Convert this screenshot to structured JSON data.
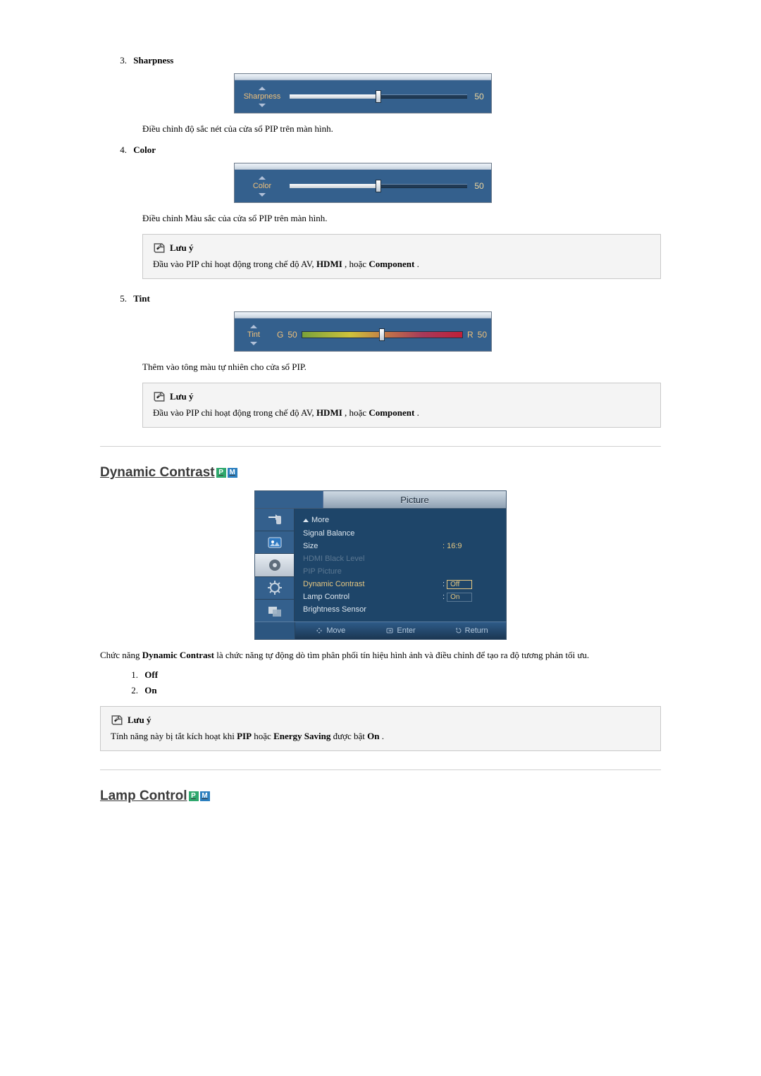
{
  "items": {
    "sharpness": {
      "number": "3.",
      "heading": "Sharpness",
      "slider_label": "Sharpness",
      "value": "50",
      "desc": "Điều chỉnh độ sắc nét của cửa sổ PIP trên màn hình."
    },
    "color": {
      "number": "4.",
      "heading": "Color",
      "slider_label": "Color",
      "value": "50",
      "desc": "Điều chỉnh Màu sắc của cửa sổ PIP trên màn hình."
    },
    "tint": {
      "number": "5.",
      "heading": "Tint",
      "slider_label": "Tint",
      "g_label": "G",
      "g_value": "50",
      "r_label": "R",
      "r_value": "50",
      "desc": "Thêm vào tông màu tự nhiên cho cửa sổ PIP."
    }
  },
  "note_pip": {
    "title": "Lưu ý",
    "text_before": "Đầu vào PIP chỉ hoạt động trong chế độ AV, ",
    "bold1": "HDMI",
    "mid": ", hoặc ",
    "bold2": "Component",
    "after": "."
  },
  "dynamic_contrast": {
    "title": "Dynamic Contrast",
    "desc_before": "Chức năng ",
    "desc_bold": "Dynamic Contrast",
    "desc_after": " là chức năng tự động dò tìm phân phối tín hiệu hình ảnh và điều chỉnh để tạo ra độ tương phản tối ưu.",
    "options": {
      "one_num": "1.",
      "one": "Off",
      "two_num": "2.",
      "two": "On"
    }
  },
  "note_dc": {
    "title": "Lưu ý",
    "text_before": "Tính năng này bị tắt kích hoạt khi ",
    "bold1": "PIP",
    "mid": " hoặc ",
    "bold2": "Energy Saving",
    "after1": " được bật ",
    "bold3": "On",
    "after2": "."
  },
  "lamp_control": {
    "title": "Lamp Control"
  },
  "osd": {
    "title": "Picture",
    "more": "More",
    "rows": {
      "signal_balance": {
        "label": "Signal Balance",
        "value": ""
      },
      "size": {
        "label": "Size",
        "value": "16:9"
      },
      "hdmi_black": {
        "label": "HDMI Black Level",
        "value": ""
      },
      "pip_picture": {
        "label": "PIP Picture",
        "value": ""
      },
      "dyn_contrast": {
        "label": "Dynamic Contrast",
        "value": "Off"
      },
      "lamp_control": {
        "label": "Lamp Control",
        "value": "On"
      },
      "brightness_sensor": {
        "label": "Brightness Sensor",
        "value": ""
      }
    },
    "foot": {
      "move": "Move",
      "enter": "Enter",
      "ret": "Return"
    }
  }
}
